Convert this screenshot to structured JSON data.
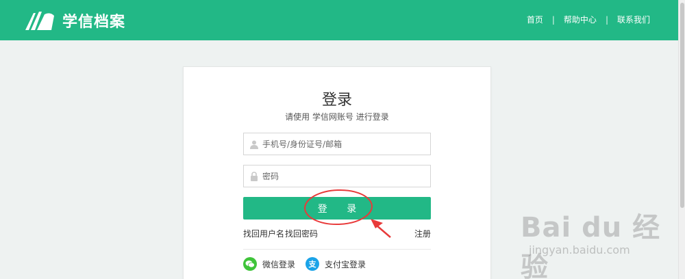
{
  "header": {
    "logo_text": "学信档案",
    "nav": [
      {
        "label": "首页"
      },
      {
        "label": "帮助中心"
      },
      {
        "label": "联系我们"
      }
    ],
    "separator": "|"
  },
  "login": {
    "title": "登录",
    "subtitle": "请使用 学信网账号 进行登录",
    "username_placeholder": "手机号/身份证号/邮箱",
    "password_placeholder": "密码",
    "button_label": "登 录",
    "find_username": "找回用户名",
    "find_password": "找回密码",
    "register": "注册",
    "wechat_login": "微信登录",
    "alipay_login": "支付宝登录",
    "alipay_glyph": "支"
  },
  "watermark": {
    "main": "Bai du 经验",
    "sub": "jingyan.baidu.com"
  },
  "colors": {
    "brand_green": "#22b886",
    "annotation_red": "#e83a3a",
    "wechat_green": "#3fc43a",
    "alipay_blue": "#1aa3e8"
  }
}
